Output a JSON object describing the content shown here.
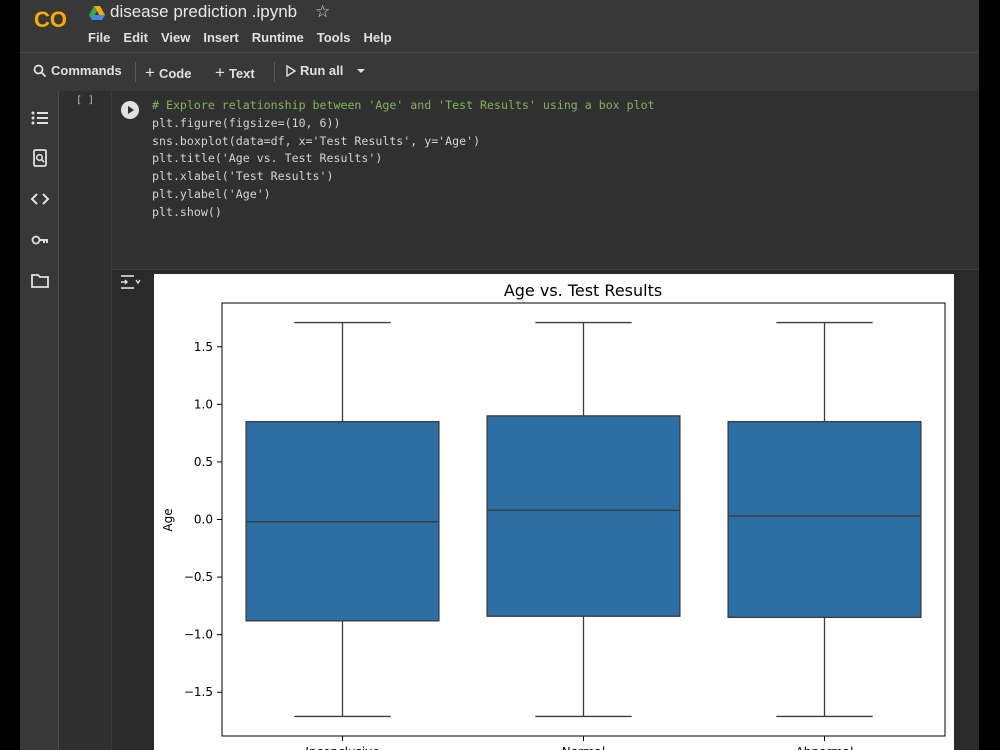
{
  "app": {
    "logo": "CO",
    "notebook_title": "disease prediction .ipynb",
    "icons": {
      "drive": "google-drive-icon",
      "star": "star-icon"
    }
  },
  "menu": [
    "File",
    "Edit",
    "View",
    "Insert",
    "Runtime",
    "Tools",
    "Help"
  ],
  "toolbar": {
    "commands_label": "Commands",
    "code_label": "Code",
    "text_label": "Text",
    "run_all_label": "Run all"
  },
  "rail": [
    "table-of-contents-icon",
    "find-icon",
    "code-snippets-icon",
    "secrets-key-icon",
    "files-folder-icon"
  ],
  "cell": {
    "execution_count": "[ ]",
    "code_lines": [
      "# Explore relationship between 'Age' and 'Test Results' using a box plot",
      "plt.figure(figsize=(10, 6))",
      "sns.boxplot(data=df, x='Test Results', y='Age')",
      "plt.title('Age vs. Test Results')",
      "plt.xlabel('Test Results')",
      "plt.ylabel('Age')",
      "plt.show()"
    ]
  },
  "colors": {
    "box_fill": "#2b6fa5",
    "accent_logo": "#f9ab00"
  },
  "chart_data": {
    "type": "box",
    "title": "Age vs. Test Results",
    "ylabel": "Age",
    "xlabel": "Test Results",
    "categories": [
      "Inconclusive",
      "Normal",
      "Abnormal"
    ],
    "boxes": [
      {
        "min": -1.71,
        "q1": -0.88,
        "median": -0.02,
        "q3": 0.85,
        "max": 1.71
      },
      {
        "min": -1.71,
        "q1": -0.84,
        "median": 0.08,
        "q3": 0.9,
        "max": 1.71
      },
      {
        "min": -1.71,
        "q1": -0.85,
        "median": 0.03,
        "q3": 0.85,
        "max": 1.71
      }
    ],
    "yticks": [
      1.5,
      1.0,
      0.5,
      0.0,
      -0.5,
      -1.0,
      -1.5
    ],
    "ytick_labels": [
      "1.5",
      "1.0",
      "0.5",
      "0.0",
      "−0.5",
      "−1.0",
      "−1.5"
    ],
    "ylim": [
      -1.88,
      1.88
    ],
    "grid": false
  }
}
